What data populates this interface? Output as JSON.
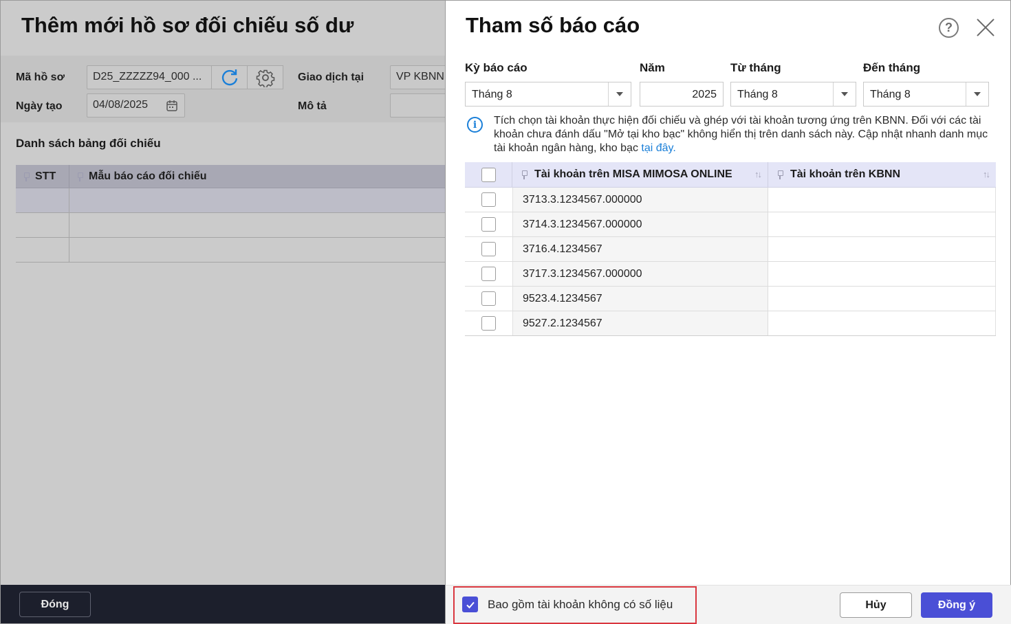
{
  "background": {
    "title": "Thêm mới hồ sơ đối chiếu số dư",
    "ma_ho_so_label": "Mã hồ sơ",
    "ma_ho_so_value": "D25_ZZZZZ94_000 ...",
    "giao_dich_label": "Giao dịch tại",
    "giao_dich_value": "VP KBNN",
    "ngay_tao_label": "Ngày tạo",
    "ngay_tao_value": "04/08/2025",
    "mo_ta_label": "Mô tả",
    "section_title": "Danh sách bảng đối chiếu",
    "columns": [
      "STT",
      "Mẫu báo cáo đối chiếu"
    ],
    "close_button": "Đóng"
  },
  "drawer": {
    "title": "Tham số báo cáo",
    "help_icon": "?",
    "fields": {
      "ky_bao_cao": {
        "label": "Kỳ báo cáo",
        "value": "Tháng 8"
      },
      "nam": {
        "label": "Năm",
        "value": "2025"
      },
      "tu_thang": {
        "label": "Từ tháng",
        "value": "Tháng 8"
      },
      "den_thang": {
        "label": "Đến tháng",
        "value": "Tháng 8"
      }
    },
    "info": {
      "text": "Tích chọn tài khoản thực hiện đối chiếu và ghép với tài khoản tương ứng trên KBNN. Đối với các tài khoản chưa đánh dấu \"Mở tại kho bạc\" không hiển thị trên danh sách này. Cập nhật nhanh danh mục tài khoản ngân hàng, kho bạc ",
      "link": "tại đây."
    },
    "grid": {
      "col_misa": "Tài khoản trên MISA MIMOSA ONLINE",
      "col_kbnn": "Tài khoản trên KBNN",
      "sort_icon": "↑↓",
      "rows": [
        {
          "account": "3713.3.1234567.000000",
          "kbnn": ""
        },
        {
          "account": "3714.3.1234567.000000",
          "kbnn": ""
        },
        {
          "account": "3716.4.1234567",
          "kbnn": ""
        },
        {
          "account": "3717.3.1234567.000000",
          "kbnn": ""
        },
        {
          "account": "9523.4.1234567",
          "kbnn": ""
        },
        {
          "account": "9527.2.1234567",
          "kbnn": ""
        }
      ]
    },
    "footer": {
      "include_label": "Bao gồm tài khoản không có số liệu",
      "include_checked": true,
      "cancel": "Hủy",
      "ok": "Đồng ý"
    }
  },
  "colors": {
    "accent": "#4a4fd6",
    "link": "#1a7fd8",
    "highlight": "#d9363e",
    "footer_dark": "#1c1f2c"
  }
}
